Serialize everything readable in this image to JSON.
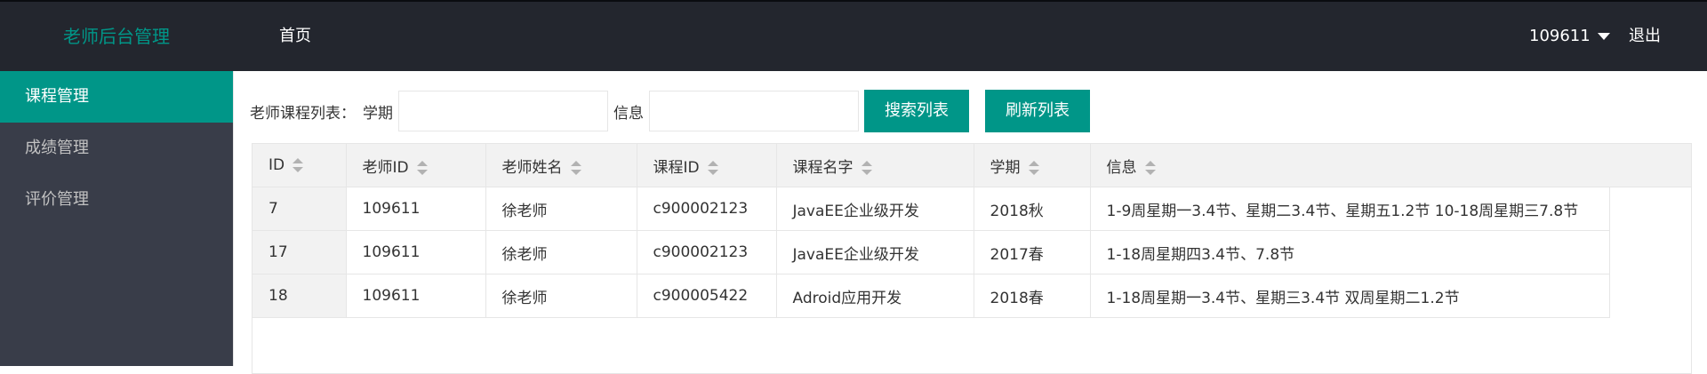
{
  "header": {
    "logo": "老师后台管理",
    "nav_home": "首页",
    "user": "109611",
    "logout": "退出"
  },
  "sidebar": {
    "items": [
      {
        "label": "课程管理",
        "active": true
      },
      {
        "label": "成绩管理",
        "active": false
      },
      {
        "label": "评价管理",
        "active": false
      }
    ]
  },
  "search": {
    "title": "老师课程列表：",
    "term_label": "学期",
    "term_value": "",
    "info_label": "信息",
    "info_value": "",
    "search_button": "搜索列表",
    "refresh_button": "刷新列表"
  },
  "table": {
    "columns": [
      "ID",
      "老师ID",
      "老师姓名",
      "课程ID",
      "课程名字",
      "学期",
      "信息"
    ],
    "rows": [
      [
        "7",
        "109611",
        "徐老师",
        "c900002123",
        "JavaEE企业级开发",
        "2018秋",
        "1-9周星期一3.4节、星期二3.4节、星期五1.2节 10-18周星期三7.8节"
      ],
      [
        "17",
        "109611",
        "徐老师",
        "c900002123",
        "JavaEE企业级开发",
        "2017春",
        "1-18周星期四3.4节、7.8节"
      ],
      [
        "18",
        "109611",
        "徐老师",
        "c900005422",
        "Adroid应用开发",
        "2018春",
        "1-18周星期一3.4节、星期三3.4节 双周星期二1.2节"
      ]
    ]
  },
  "colors": {
    "accent": "#009688",
    "header_bg": "#23262e",
    "sidebar_bg": "#393d49",
    "table_header_bg": "#f2f2f2"
  }
}
